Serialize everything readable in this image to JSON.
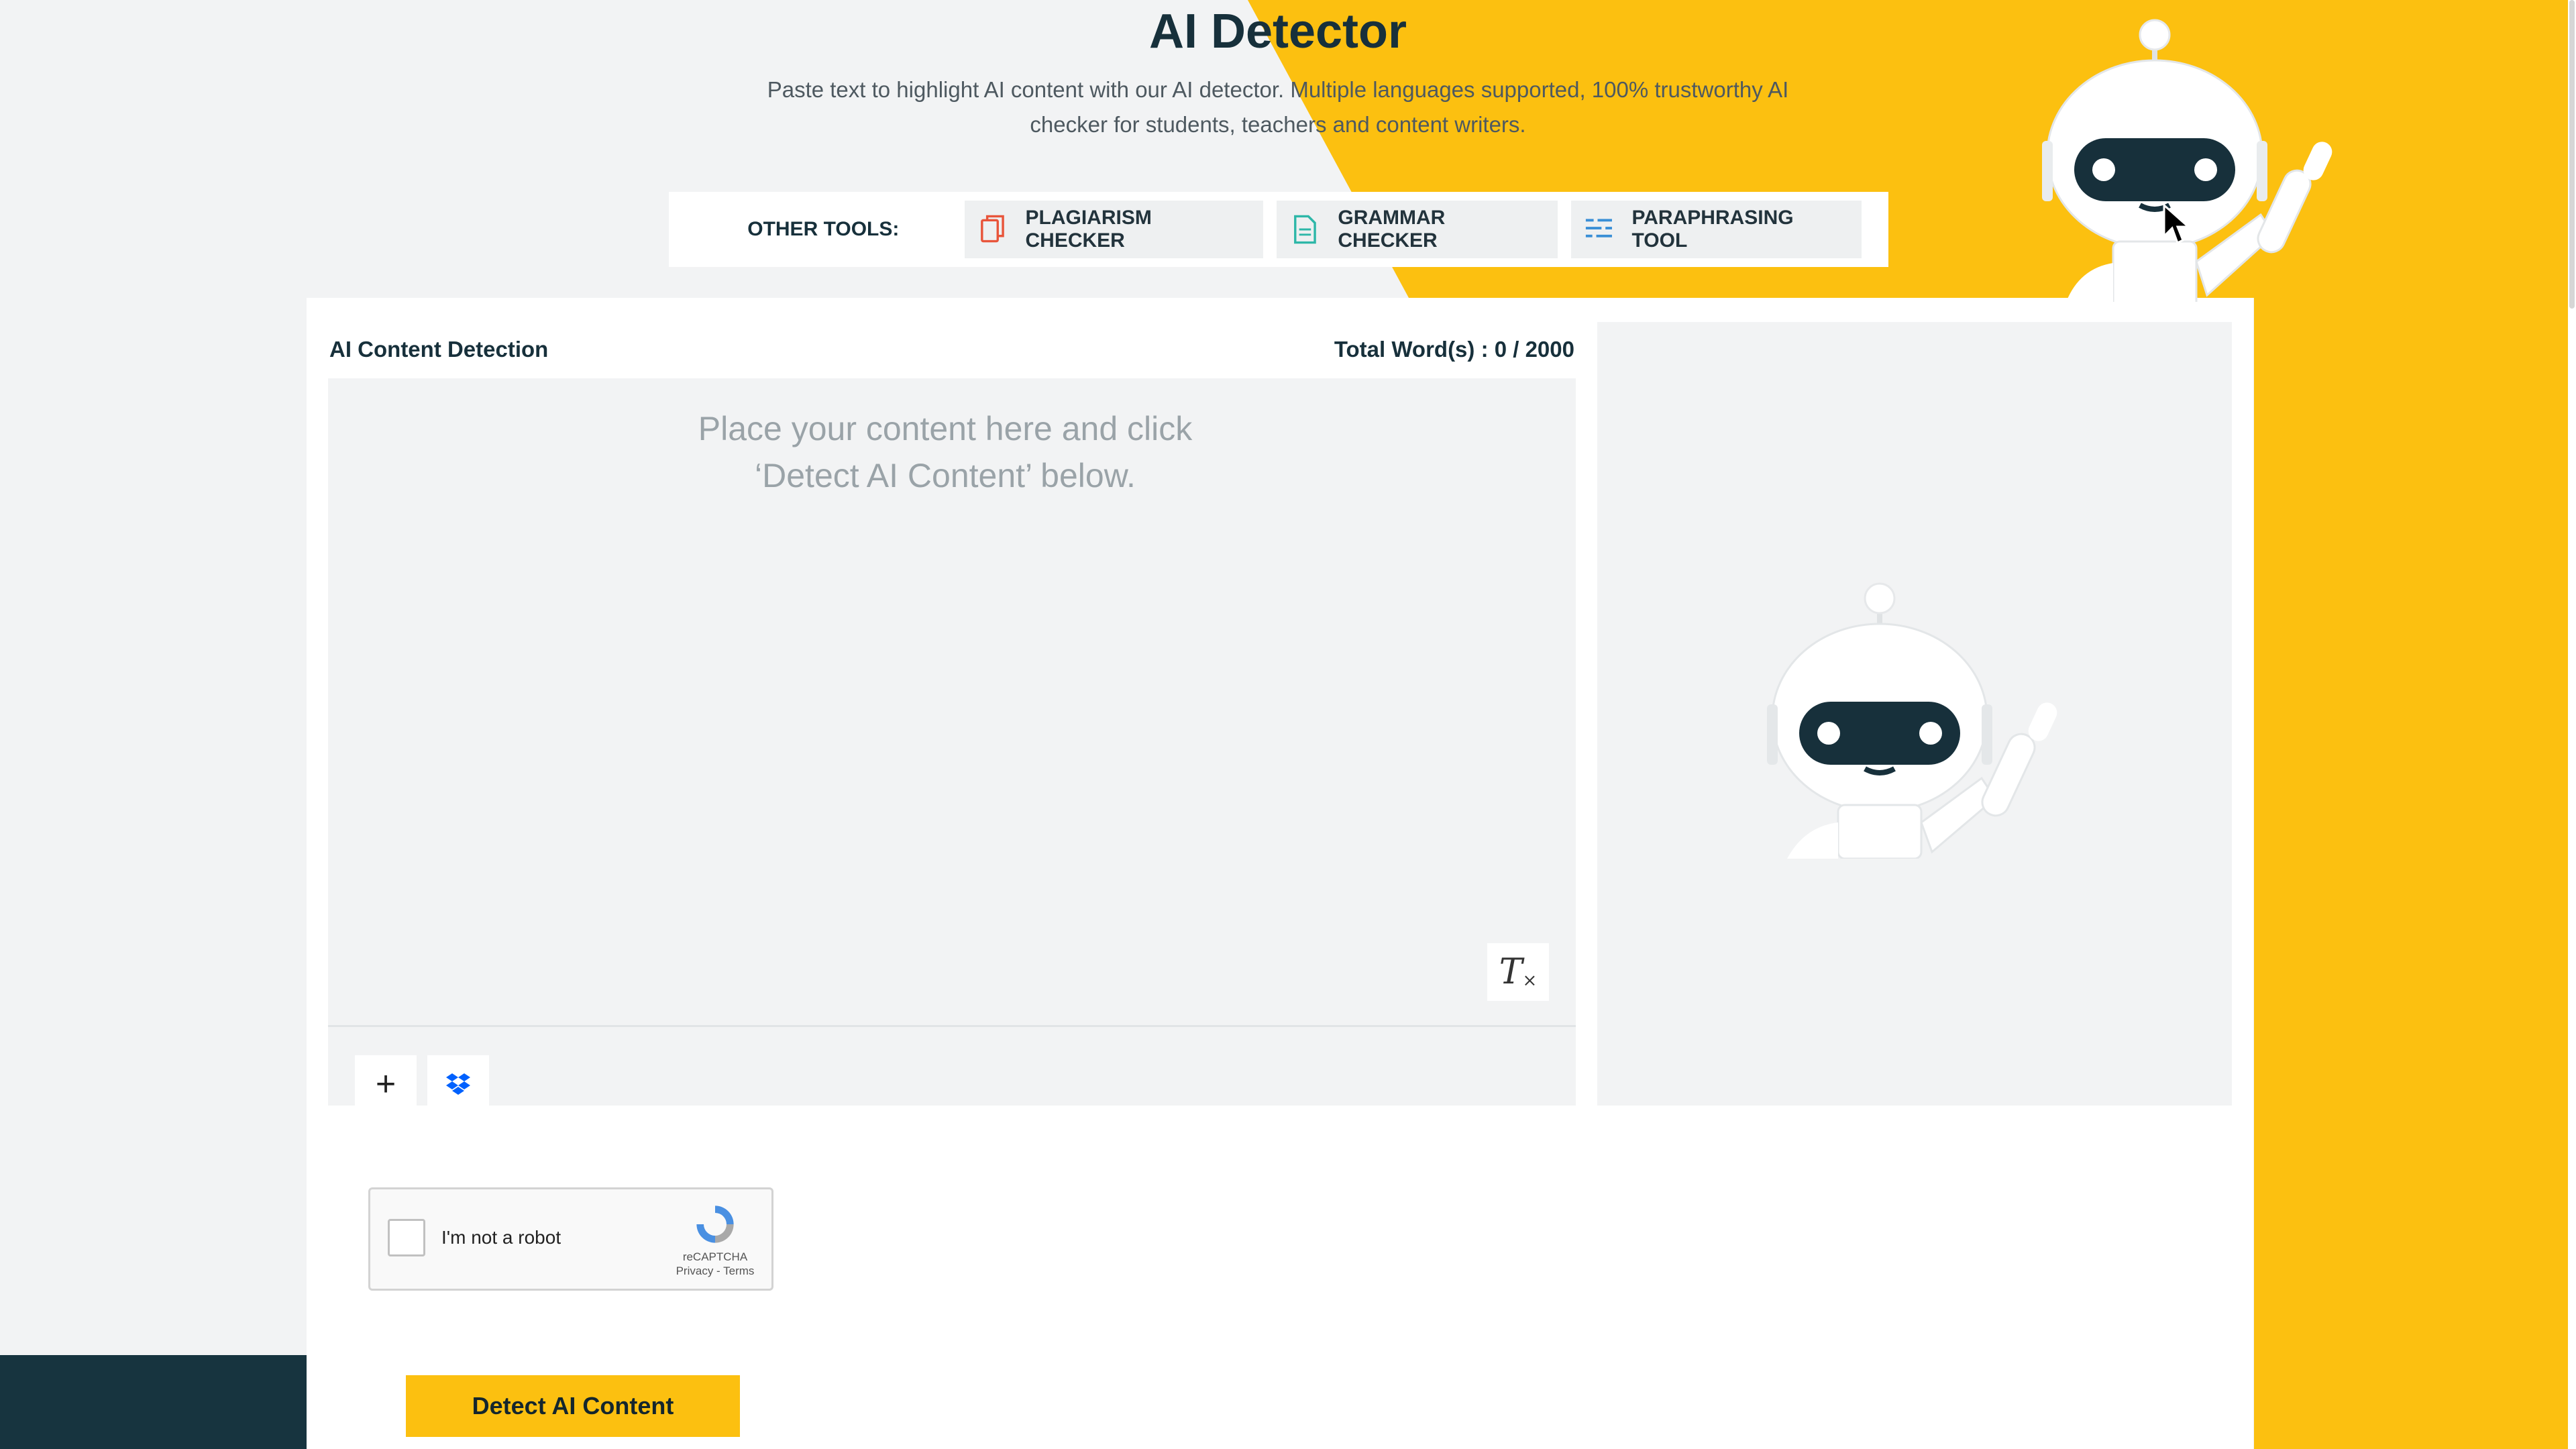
{
  "page": {
    "title": "AI Detector",
    "subtitle": "Paste text to highlight AI content with our AI detector. Multiple languages supported, 100% trustworthy AI checker for students, teachers and content writers.",
    "colors": {
      "accent": "#fcc010",
      "dark": "#17343f",
      "panel": "#f2f3f4"
    }
  },
  "tools": {
    "label": "OTHER TOOLS:",
    "items": [
      {
        "label": "PLAGIARISM CHECKER",
        "icon": "copy-document-icon"
      },
      {
        "label": "GRAMMAR CHECKER",
        "icon": "document-icon"
      },
      {
        "label": "PARAPHRASING TOOL",
        "icon": "lines-icon"
      }
    ]
  },
  "detector": {
    "header": "AI Content Detection",
    "word_count": "Total Word(s) : 0 / 2000",
    "placeholder_line1": "Place your content here and click",
    "placeholder_line2": "‘Detect AI Content’ below.",
    "clear_icon": "clear-format-icon",
    "add_icon": "plus-icon",
    "dropbox_icon": "dropbox-icon"
  },
  "captcha": {
    "label": "I'm not a robot",
    "brand": "reCAPTCHA",
    "links": "Privacy - Terms"
  },
  "actions": {
    "detect_label": "Detect AI Content"
  }
}
